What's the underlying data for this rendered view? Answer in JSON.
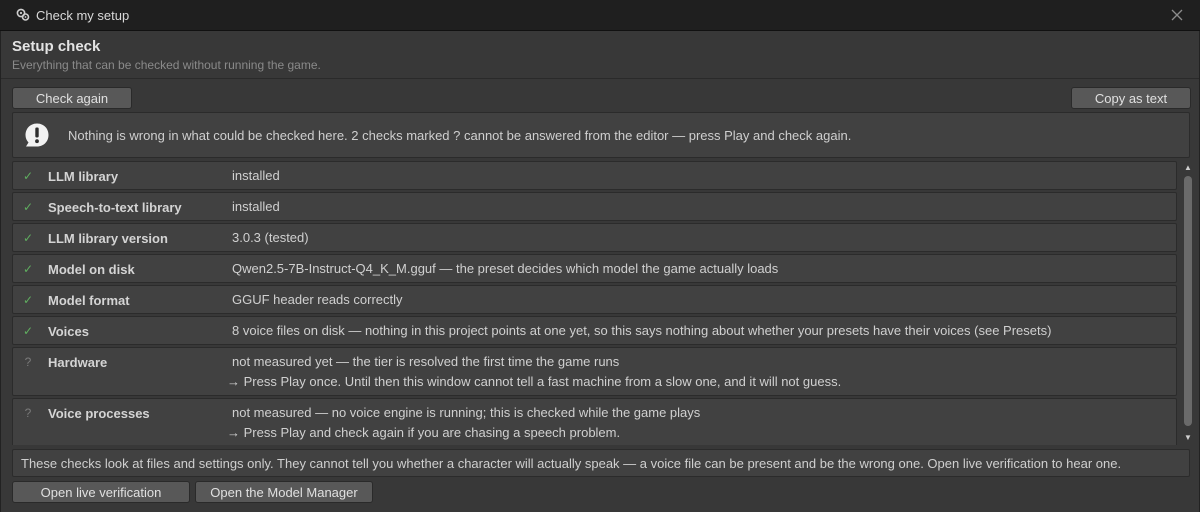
{
  "window": {
    "title": "Check my setup",
    "icons": {
      "app": "gear-cluster-icon",
      "close": "close-icon"
    }
  },
  "header": {
    "title": "Setup check",
    "subtitle": "Everything that can be checked without running the game."
  },
  "toolbar": {
    "check_again": "Check again",
    "copy_as_text": "Copy as text"
  },
  "notice": {
    "icon": "warning-icon",
    "text": "Nothing is wrong in what could be checked here. 2 checks marked ? cannot be answered from the editor — press Play and check again."
  },
  "checks": [
    {
      "status": "✓",
      "state": "ok",
      "name": "LLM library",
      "value": "installed"
    },
    {
      "status": "✓",
      "state": "ok",
      "name": "Speech-to-text library",
      "value": "installed"
    },
    {
      "status": "✓",
      "state": "ok",
      "name": "LLM library version",
      "value": "3.0.3 (tested)"
    },
    {
      "status": "✓",
      "state": "ok",
      "name": "Model on disk",
      "value": "Qwen2.5-7B-Instruct-Q4_K_M.gguf — the preset decides which model the game actually loads"
    },
    {
      "status": "✓",
      "state": "ok",
      "name": "Model format",
      "value": "GGUF header reads correctly"
    },
    {
      "status": "✓",
      "state": "ok",
      "name": "Voices",
      "value": "8 voice files on disk — nothing in this project points at one yet, so this says nothing about whether your presets have their voices (see Presets)"
    },
    {
      "status": "?",
      "state": "unknown",
      "name": "Hardware",
      "value": "not measured yet — the tier is resolved the first time the game runs",
      "hint": "→ Press Play once. Until then this window cannot tell a fast machine from a slow one, and it will not guess."
    },
    {
      "status": "?",
      "state": "unknown",
      "name": "Voice processes",
      "value": "not measured — no voice engine is running; this is checked while the game plays",
      "hint": "→ Press Play and check again if you are chasing a speech problem."
    }
  ],
  "footer": {
    "text": "These checks look at files and settings only. They cannot tell you whether a character will actually speak — a voice file can be present and be the wrong one. Open live verification to hear one."
  },
  "actions": {
    "open_live_verification": "Open live verification",
    "open_model_manager": "Open the Model Manager"
  },
  "colors": {
    "background": "#383838",
    "panel": "#414141",
    "button": "#585858",
    "ok": "#5fae5f"
  }
}
